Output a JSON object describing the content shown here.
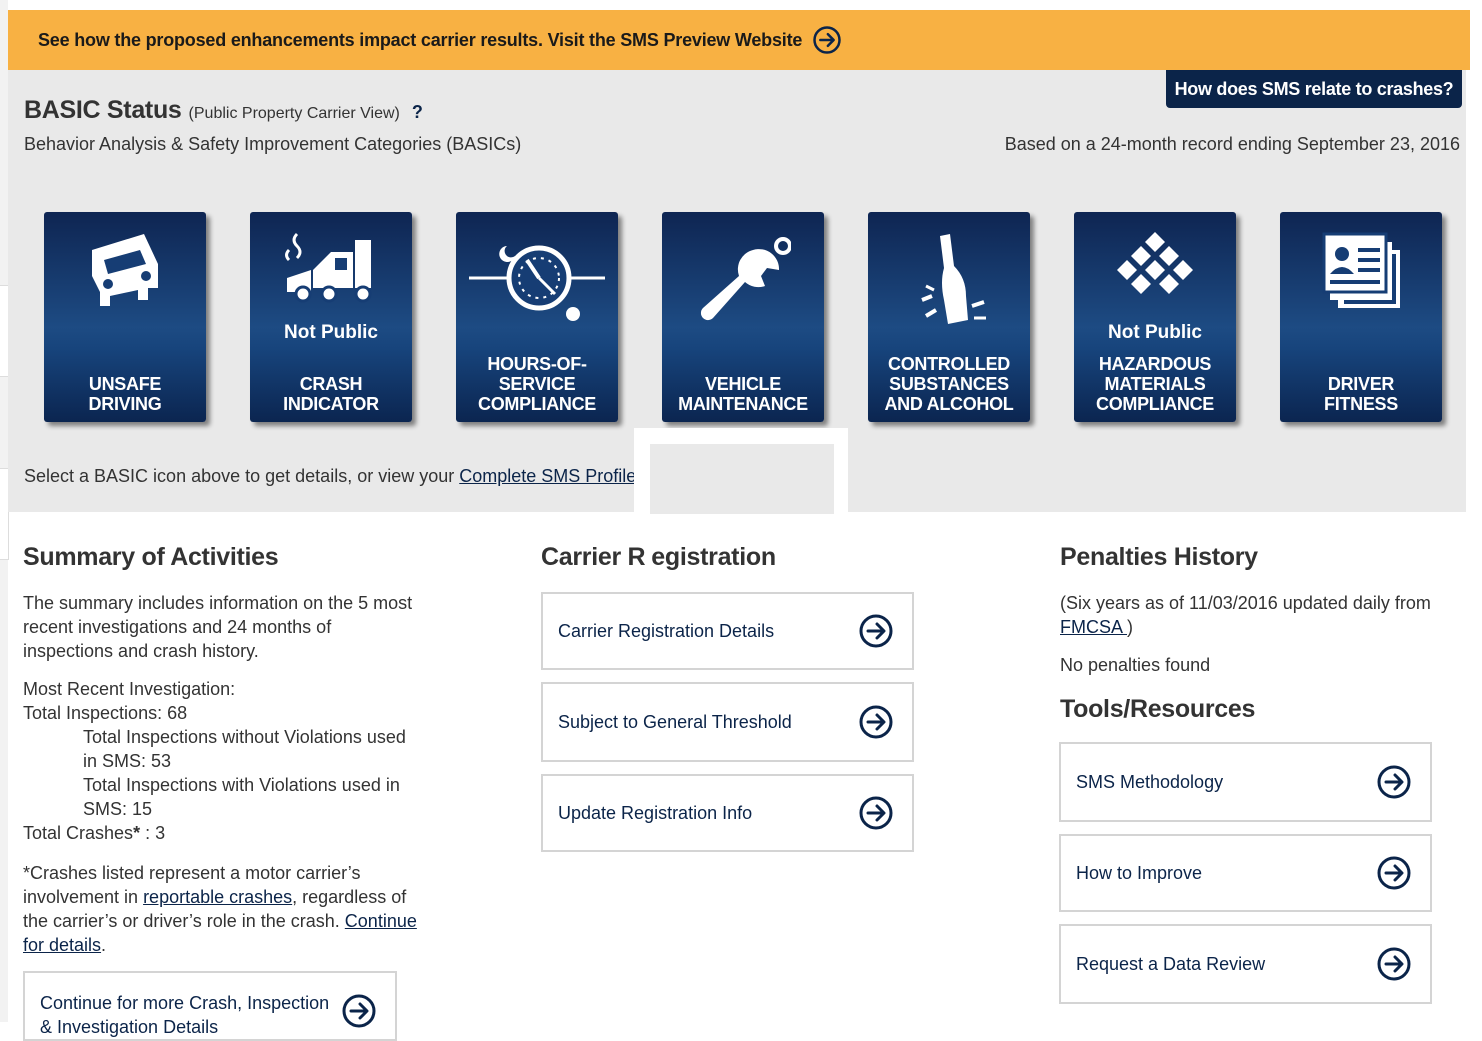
{
  "banner": {
    "text": "See how the proposed enhancements impact carrier results. Visit the SMS Preview Website",
    "icon": "arrow-circle-right-icon"
  },
  "status": {
    "crash_button": "How does SMS relate to crashes?",
    "title": "BASIC Status",
    "view": "(Public Property Carrier View)",
    "help": "?",
    "subtitle": "Behavior Analysis & Safety Improvement Categories (BASICs)",
    "record": "Based on a 24-month record ending September 23, 2016",
    "select_prefix": "Select a BASIC icon above to get details, or view your ",
    "select_link": "Complete SMS Profile",
    "select_suffix": "."
  },
  "tiles": [
    {
      "label_1": "UNSAFE",
      "label_2": "DRIVING",
      "label_3": "",
      "not_public": "",
      "icon": "truck-icon"
    },
    {
      "label_1": "CRASH",
      "label_2": "INDICATOR",
      "label_3": "",
      "not_public": "Not Public",
      "icon": "crash-icon"
    },
    {
      "label_1": "HOURS-OF-",
      "label_2": "SERVICE",
      "label_3": "COMPLIANCE",
      "not_public": "",
      "icon": "clock-icon"
    },
    {
      "label_1": "VEHICLE",
      "label_2": "MAINTENANCE",
      "label_3": "",
      "not_public": "",
      "icon": "wrench-icon"
    },
    {
      "label_1": "CONTROLLED",
      "label_2": "SUBSTANCES",
      "label_3": "AND ALCOHOL",
      "not_public": "",
      "icon": "bottle-icon"
    },
    {
      "label_1": "HAZARDOUS",
      "label_2": "MATERIALS",
      "label_3": "COMPLIANCE",
      "not_public": "Not Public",
      "icon": "hazmat-diamond-icon"
    },
    {
      "label_1": "DRIVER",
      "label_2": "FITNESS",
      "label_3": "",
      "not_public": "",
      "icon": "id-card-icon"
    }
  ],
  "summary": {
    "title": "Summary of Activities",
    "intro_1": "The summary includes information on the 5 most",
    "intro_2": "recent investigations and 24 months of",
    "intro_3": "inspections and crash history.",
    "recent_investigation": "Most Recent Investigation:",
    "total_inspections": "Total Inspections: 68",
    "without_1": "Total Inspections without Violations used",
    "without_2": "in SMS: 53",
    "with_1": "Total Inspections with Violations used in",
    "with_2": "SMS: 15",
    "total_crashes_prefix": "Total Crashes",
    "total_crashes_star": "*",
    "total_crashes_value": " : 3",
    "note_1": "*Crashes listed represent a motor carrier’s",
    "note_2_prefix": "involvement in ",
    "note_2_link": "reportable crashes",
    "note_2_suffix": ", regardless of",
    "note_3_prefix": "the carrier’s or driver’s role in the crash. ",
    "note_3_link": "Continue",
    "note_4_link": "for details",
    "note_4_suffix": ".",
    "continue_box_1": "Continue for more Crash, Inspection",
    "continue_box_2": "& Investigation Details"
  },
  "registration": {
    "title_a": "Carrier R",
    "title_b": "egistration",
    "links": [
      "Carrier Registration Details",
      "Subject to General Threshold",
      "Update Registration Info"
    ]
  },
  "penalties": {
    "title": "Penalties History",
    "note_1": "(Six years as of 11/03/2016 updated daily from",
    "note_link": "FMCSA ",
    "note_end": ")",
    "none": "No penalties found"
  },
  "tools": {
    "title": "Tools/Resources",
    "links": [
      "SMS Methodology",
      "How to Improve",
      "Request a Data Review"
    ]
  },
  "colors": {
    "banner": "#f8b143",
    "navy": "#0b2449",
    "panel": "#e9e9e9"
  }
}
